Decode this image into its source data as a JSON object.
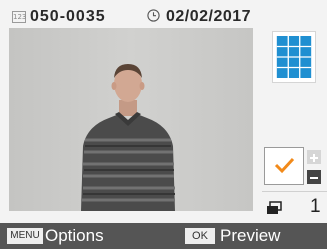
{
  "header": {
    "file_icon_label": "123",
    "file_number": "050-0035",
    "date": "02/02/2017"
  },
  "photo": {
    "description_icon": "portrait-photo"
  },
  "side_panel": {
    "layout_icon": "grid-layout-icon",
    "selection_icon": "checkmark-icon",
    "copies_icon": "prints-icon",
    "copies": "1"
  },
  "footer": {
    "menu_key": "MENU",
    "menu_label": "Options",
    "ok_key": "OK",
    "ok_label": "Preview"
  },
  "colors": {
    "accent": "#1f8fd1",
    "check": "#f28a1a",
    "bar": "#555555"
  }
}
